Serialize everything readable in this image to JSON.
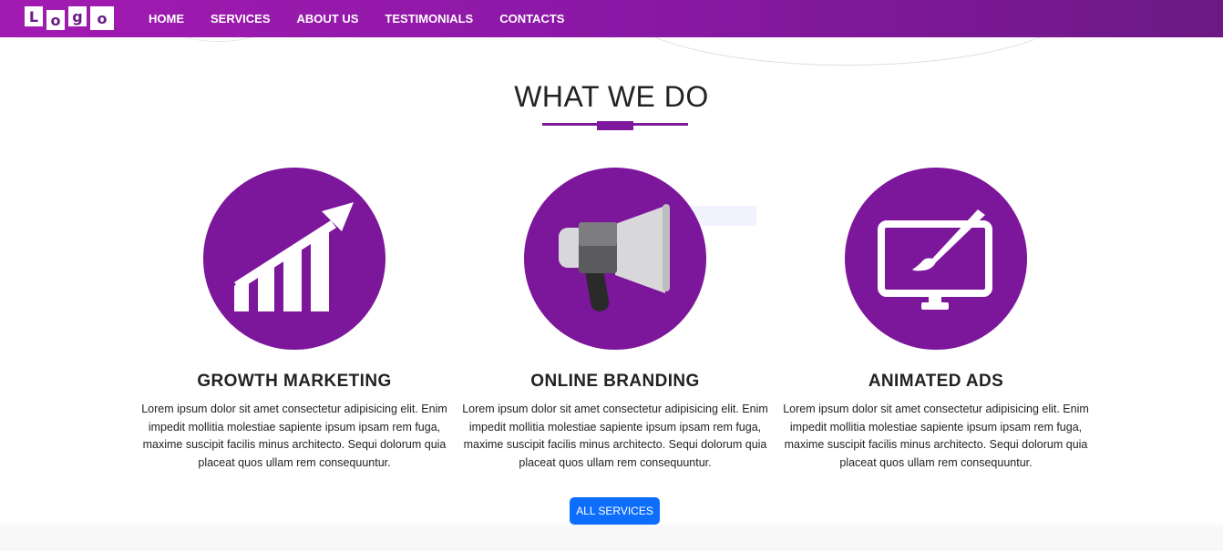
{
  "nav": {
    "logo_letters": [
      "L",
      "o",
      "g",
      "o"
    ],
    "links": [
      "HOME",
      "SERVICES",
      "ABOUT US",
      "TESTIMONIALS",
      "CONTACTS"
    ]
  },
  "section": {
    "title": "WHAT WE DO"
  },
  "services": [
    {
      "title": "GROWTH MARKETING",
      "text": "Lorem ipsum dolor sit amet consectetur adipisicing elit. Enim impedit mollitia molestiae sapiente ipsum ipsam rem fuga, maxime suscipit facilis minus architecto. Sequi dolorum quia placeat quos ullam rem consequuntur.",
      "icon": "growth-chart-icon"
    },
    {
      "title": "ONLINE BRANDING",
      "text": "Lorem ipsum dolor sit amet consectetur adipisicing elit. Enim impedit mollitia molestiae sapiente ipsum ipsam rem fuga, maxime suscipit facilis minus architecto. Sequi dolorum quia placeat quos ullam rem consequuntur.",
      "icon": "megaphone-icon"
    },
    {
      "title": "ANIMATED ADS",
      "text": "Lorem ipsum dolor sit amet consectetur adipisicing elit. Enim impedit mollitia molestiae sapiente ipsum ipsam rem fuga, maxime suscipit facilis minus architecto. Sequi dolorum quia placeat quos ullam rem consequuntur.",
      "icon": "monitor-brush-icon"
    }
  ],
  "cta": {
    "label": "ALL SERVICES"
  },
  "colors": {
    "brand_purple": "#7c169b",
    "nav_gradient_start": "#a21bb0",
    "nav_gradient_end": "#6c1985",
    "button_blue": "#0d6efd"
  }
}
